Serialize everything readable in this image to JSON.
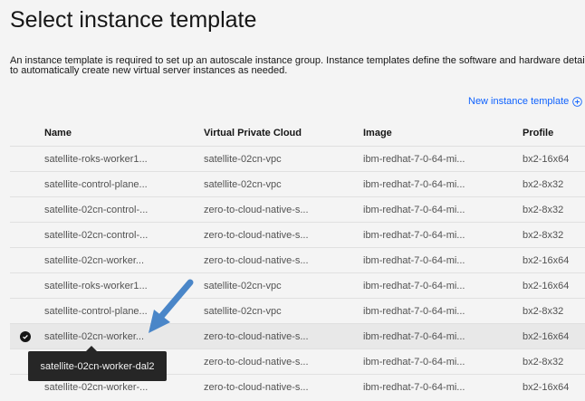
{
  "page": {
    "title": "Select instance template",
    "description_line1": "An instance template is required to set up an autoscale instance group. Instance templates define the software and hardware details",
    "description_line2": "to automatically create new virtual server instances as needed.",
    "new_template_label": "New instance template"
  },
  "table": {
    "columns": [
      "Name",
      "Virtual Private Cloud",
      "Image",
      "Profile"
    ],
    "rows": [
      {
        "name": "satellite-roks-worker1...",
        "vpc": "satellite-02cn-vpc",
        "image": "ibm-redhat-7-0-64-mi...",
        "profile": "bx2-16x64"
      },
      {
        "name": "satellite-control-plane...",
        "vpc": "satellite-02cn-vpc",
        "image": "ibm-redhat-7-0-64-mi...",
        "profile": "bx2-8x32"
      },
      {
        "name": "satellite-02cn-control-...",
        "vpc": "zero-to-cloud-native-s...",
        "image": "ibm-redhat-7-0-64-mi...",
        "profile": "bx2-8x32"
      },
      {
        "name": "satellite-02cn-control-...",
        "vpc": "zero-to-cloud-native-s...",
        "image": "ibm-redhat-7-0-64-mi...",
        "profile": "bx2-8x32"
      },
      {
        "name": "satellite-02cn-worker...",
        "vpc": "zero-to-cloud-native-s...",
        "image": "ibm-redhat-7-0-64-mi...",
        "profile": "bx2-16x64"
      },
      {
        "name": "satellite-roks-worker1...",
        "vpc": "satellite-02cn-vpc",
        "image": "ibm-redhat-7-0-64-mi...",
        "profile": "bx2-16x64"
      },
      {
        "name": "satellite-control-plane...",
        "vpc": "satellite-02cn-vpc",
        "image": "ibm-redhat-7-0-64-mi...",
        "profile": "bx2-8x32"
      },
      {
        "name": "satellite-02cn-worker...",
        "vpc": "zero-to-cloud-native-s...",
        "image": "ibm-redhat-7-0-64-mi...",
        "profile": "bx2-16x64",
        "selected": true
      },
      {
        "name": "satellite-02cn-worker-...",
        "vpc": "zero-to-cloud-native-s...",
        "image": "ibm-redhat-7-0-64-mi...",
        "profile": "bx2-8x32"
      },
      {
        "name": "satellite-02cn-worker-...",
        "vpc": "zero-to-cloud-native-s...",
        "image": "ibm-redhat-7-0-64-mi...",
        "profile": "bx2-16x64"
      }
    ]
  },
  "tooltip": {
    "text": "satellite-02cn-worker-dal2"
  },
  "colors": {
    "accent": "#0f62fe",
    "annotation_arrow": "#4a86c8",
    "tooltip_bg": "#262626"
  },
  "icons": {
    "new_template": "add-circle-icon",
    "selected": "checkmark-filled-icon",
    "annotation": "arrow-icon"
  }
}
